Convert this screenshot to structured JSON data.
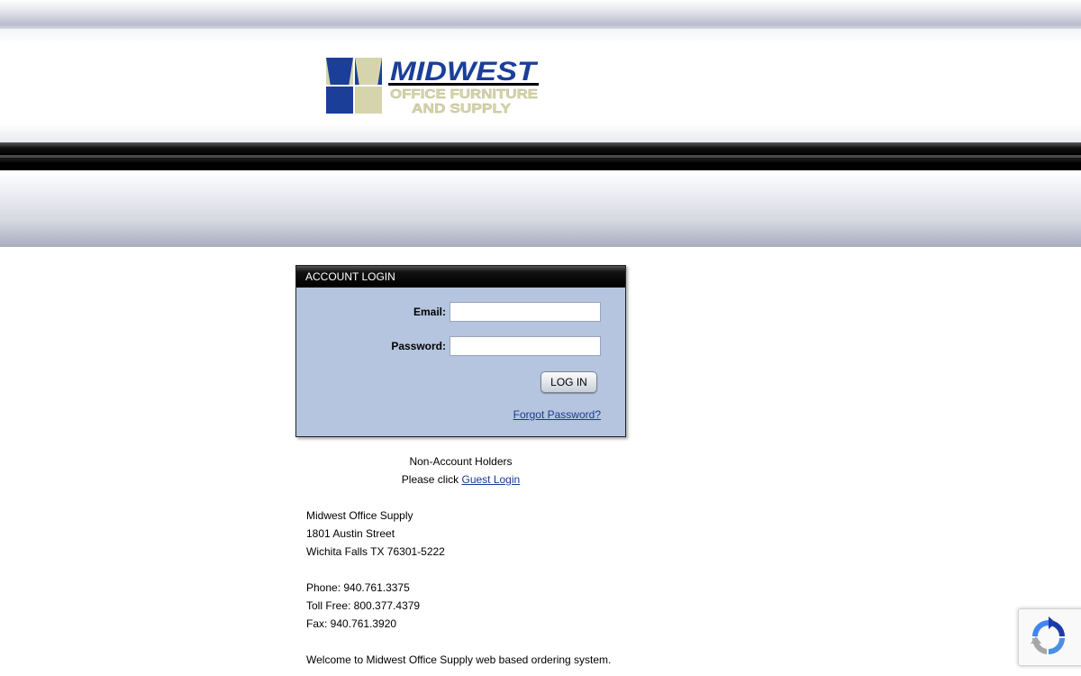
{
  "header": {
    "logo": {
      "name": "MIDWEST",
      "line2": "OFFICE FURNITURE",
      "line3": "AND SUPPLY",
      "colors": {
        "blue": "#1b3f99",
        "tan": "#d6d4ac"
      }
    }
  },
  "login": {
    "heading": "ACCOUNT LOGIN",
    "email_label": "Email:",
    "email_value": "",
    "password_label": "Password:",
    "password_value": "",
    "login_button": "LOG IN",
    "forgot_link": "Forgot Password?",
    "panel_color": "#b5c5df"
  },
  "guest": {
    "line1": "Non-Account Holders",
    "prefix": "Please click",
    "link": "Guest Login"
  },
  "company": {
    "name": "Midwest Office Supply",
    "street": "1801 Austin Street",
    "city": "Wichita Falls TX 76301-5222",
    "phone": "Phone: 940.761.3375",
    "toll_free": "Toll Free: 800.377.4379",
    "fax": "Fax: 940.761.3920",
    "welcome": "Welcome to Midwest Office Supply web based ordering system."
  },
  "recaptcha": {
    "icon": "recaptcha-icon"
  }
}
